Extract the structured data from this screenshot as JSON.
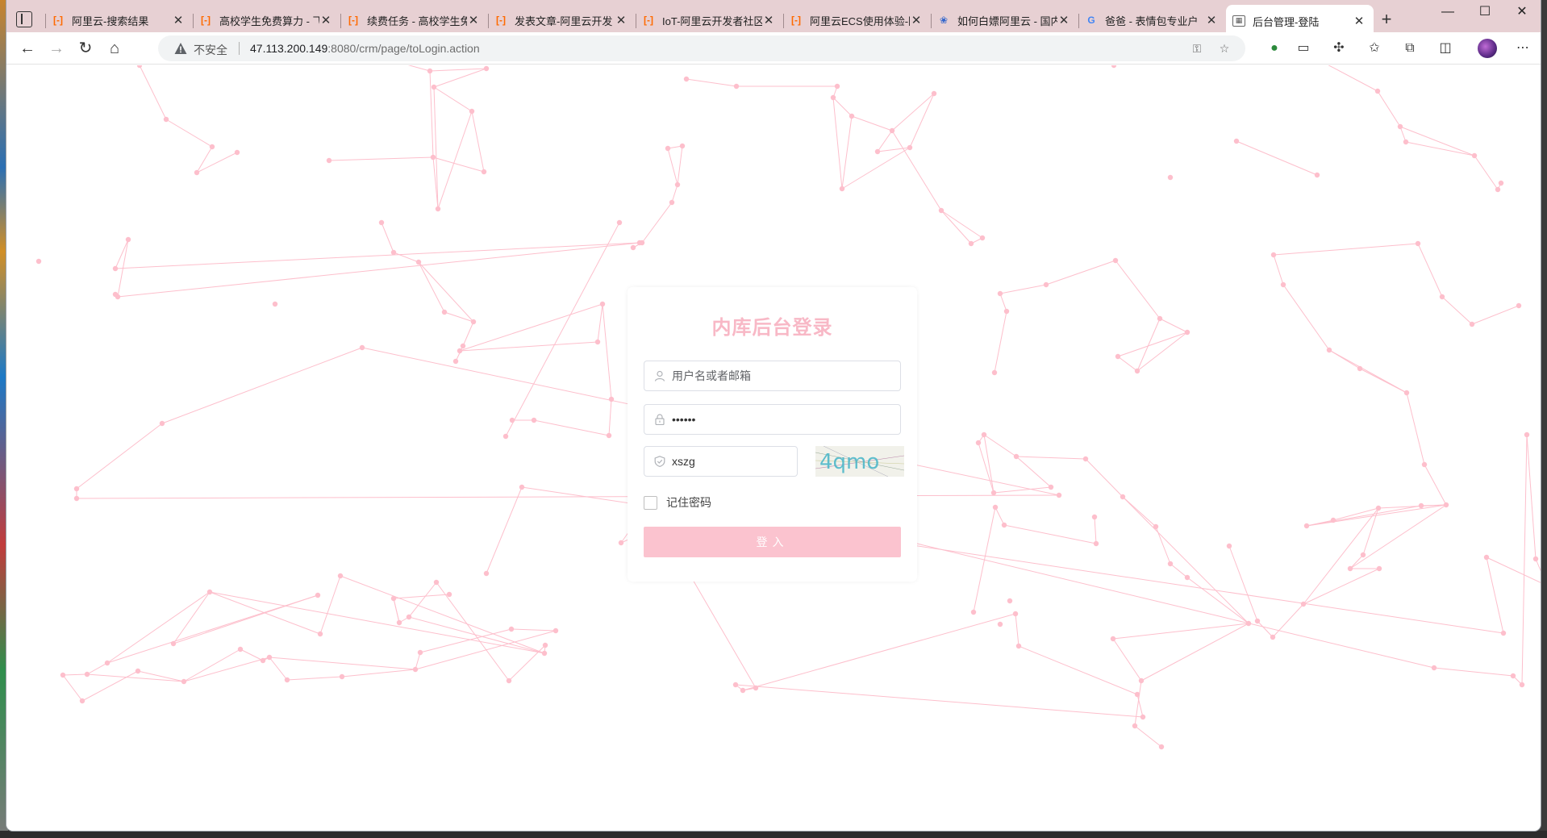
{
  "window": {
    "controls": {
      "minimize": "—",
      "maximize": "☐",
      "close": "✕"
    }
  },
  "tabs": [
    {
      "title": "阿里云-搜索结果",
      "icon": "aliyun-icon",
      "active": false
    },
    {
      "title": "高校学生免费算力 - 飞",
      "icon": "aliyun-icon",
      "active": false
    },
    {
      "title": "续费任务 - 高校学生免",
      "icon": "aliyun-icon",
      "active": false
    },
    {
      "title": "发表文章-阿里云开发",
      "icon": "aliyun-icon",
      "active": false
    },
    {
      "title": "IoT-阿里云开发者社区",
      "icon": "aliyun-icon",
      "active": false
    },
    {
      "title": "阿里云ECS使用体验-阿",
      "icon": "aliyun-icon",
      "active": false
    },
    {
      "title": "如何白嫖阿里云 - 国内",
      "icon": "baidu-paw-icon",
      "active": false
    },
    {
      "title": "爸爸 - 表情包专业户",
      "icon": "google-icon",
      "active": false
    },
    {
      "title": "后台管理-登陆",
      "icon": "page-doc-icon",
      "active": true
    }
  ],
  "toolbar": {
    "security_label": "不安全",
    "url_host": "47.113.200.149",
    "url_rest": ":8080/crm/page/toLogin.action"
  },
  "login": {
    "title": "内库后台登录",
    "username_placeholder": "用户名或者邮箱",
    "password_value": "••••••",
    "captcha_value": "xszg",
    "captcha_image_text": "4qmo",
    "remember_label": "记住密码",
    "submit_label": "登入"
  },
  "colors": {
    "accent": "#f8b8c6",
    "button": "#fbc3cf",
    "particles": "#fdbfcc",
    "tabstrip": "#e7d0d3"
  }
}
